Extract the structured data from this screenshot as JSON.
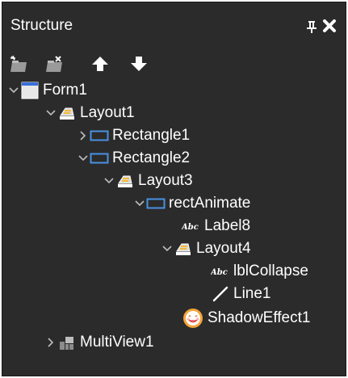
{
  "panel": {
    "title": "Structure",
    "pin_icon": "pin-icon",
    "close_icon": "close-icon"
  },
  "toolbar": {
    "buttons": [
      "add-component-icon",
      "remove-component-icon",
      "move-up-icon",
      "move-down-icon"
    ]
  },
  "tree": [
    {
      "label": "Form1",
      "icon": "form-icon",
      "expander": "expanded",
      "depth": 0
    },
    {
      "label": "Layout1",
      "icon": "layout-icon",
      "expander": "expanded",
      "depth": 1
    },
    {
      "label": "Rectangle1",
      "icon": "rectangle-icon",
      "expander": "collapsed",
      "depth": 2
    },
    {
      "label": "Rectangle2",
      "icon": "rectangle-icon",
      "expander": "expanded",
      "depth": 2
    },
    {
      "label": "Layout3",
      "icon": "layout-icon",
      "expander": "expanded",
      "depth": 3
    },
    {
      "label": "rectAnimate",
      "icon": "rectangle-icon",
      "expander": "expanded",
      "depth": 4
    },
    {
      "label": "Label8",
      "icon": "label-icon",
      "expander": "none",
      "depth": 5
    },
    {
      "label": "Layout4",
      "icon": "layout-icon",
      "expander": "expanded",
      "depth": 5
    },
    {
      "label": "lblCollapse",
      "icon": "label-icon",
      "expander": "none",
      "depth": 6
    },
    {
      "label": "Line1",
      "icon": "line-icon",
      "expander": "none",
      "depth": 6
    },
    {
      "label": "ShadowEffect1",
      "icon": "shadow-effect-icon",
      "expander": "none",
      "depth": 5
    },
    {
      "label": "MultiView1",
      "icon": "multiview-icon",
      "expander": "collapsed",
      "depth": 1
    }
  ],
  "colors": {
    "panel_bg": "#2b2b2b",
    "text": "#ffffff",
    "arrow": "#bdbdbd",
    "rect_icon": "#4a90e2"
  }
}
